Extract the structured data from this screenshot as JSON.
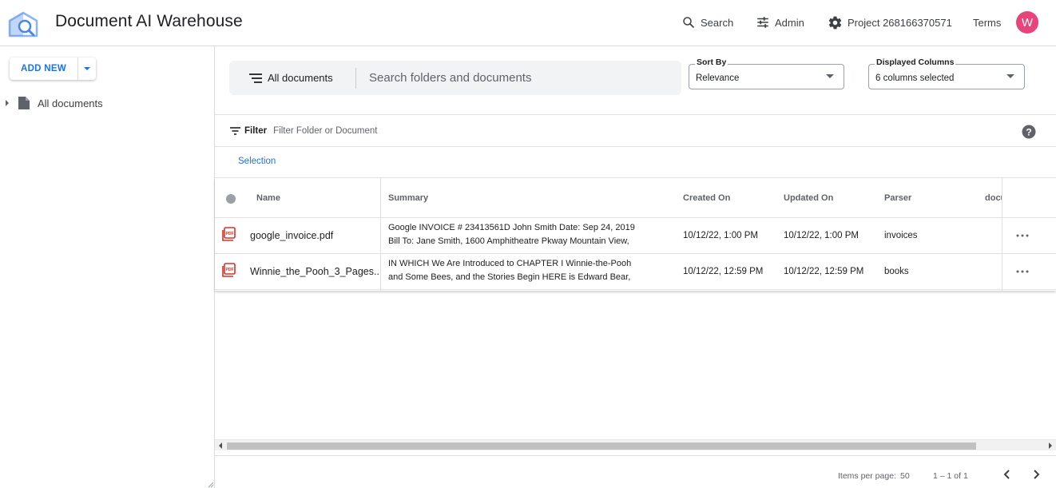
{
  "header": {
    "title": "Document AI Warehouse",
    "search_label": "Search",
    "admin_label": "Admin",
    "project_label": "Project 268166370571",
    "terms_label": "Terms",
    "avatar_initial": "W",
    "avatar_color": "#e8437a"
  },
  "sidebar": {
    "add_new_label": "ADD NEW",
    "tree_item_label": "All documents"
  },
  "search": {
    "scope_label": "All documents",
    "placeholder": "Search folders and documents"
  },
  "sort_by": {
    "label": "Sort By",
    "value": "Relevance"
  },
  "displayed_columns": {
    "label": "Displayed Columns",
    "value": "6 columns selected"
  },
  "filter": {
    "label": "Filter",
    "placeholder": "Filter Folder or Document"
  },
  "selection_label": "Selection",
  "table": {
    "columns": [
      "Name",
      "Summary",
      "Created On",
      "Updated On",
      "Parser",
      "docu"
    ],
    "rows": [
      {
        "name": "google_invoice.pdf",
        "summary_line1": "Google INVOICE # 23413561D John Smith Date: Sep 24, 2019",
        "summary_line2": "Bill To: Jane Smith, 1600 Amphitheatre Pkway Mountain View,",
        "created_on": "10/12/22, 1:00 PM",
        "updated_on": "10/12/22, 1:00 PM",
        "parser": "invoices"
      },
      {
        "name": "Winnie_the_Pooh_3_Pages....",
        "summary_line1": "IN WHICH We Are Introduced to CHAPTER I Winnie-the-Pooh",
        "summary_line2": "and Some Bees, and the Stories Begin HERE is Edward Bear,",
        "created_on": "10/12/22, 12:59 PM",
        "updated_on": "10/12/22, 12:59 PM",
        "parser": "books"
      }
    ]
  },
  "paginator": {
    "items_per_page_label": "Items per page:",
    "items_per_page_value": "50",
    "range_label": "1 – 1 of 1"
  },
  "colors": {
    "accent": "#1a73e8",
    "pdf_red": "#d93025",
    "logo_blue": "#4a86e8"
  }
}
